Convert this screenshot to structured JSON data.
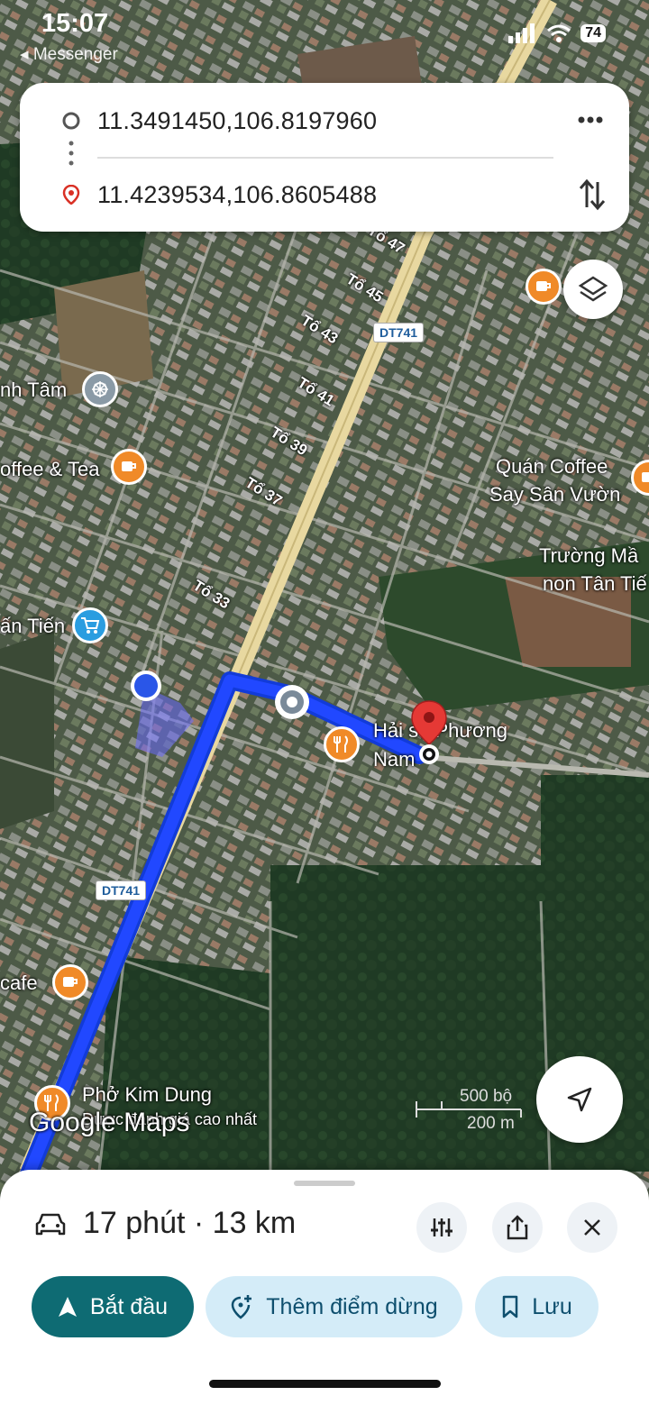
{
  "status_bar": {
    "time": "15:07",
    "back_app": "Messenger",
    "battery": "74"
  },
  "route": {
    "origin": "11.3491450,106.8197960",
    "destination": "11.4239534,106.8605488"
  },
  "map": {
    "road_shields": [
      "DT741",
      "DT741"
    ],
    "street_labels": [
      "Tổ 47",
      "Tổ 45",
      "Tổ 43",
      "Tổ 41",
      "Tổ 39",
      "Tổ 37",
      "Tổ 33"
    ],
    "places": {
      "p1": "nh Tâm",
      "p2": "offee & Tea",
      "p3_line1": "Quán Coffee",
      "p3_line2": "Say Sân Vườn",
      "p4_line1": "Trường Mầ",
      "p4_line2": "non Tân Tiế",
      "p5": "ấn Tiến",
      "p6_line1": "Hải sả Phương",
      "p6_line2": "Nam",
      "p7": "cafe",
      "p8": "Phở Kim Dung",
      "p9": "Được đánh giá cao nhất"
    },
    "watermark": "Google Maps",
    "scale": {
      "imperial": "500 bộ",
      "metric": "200 m"
    },
    "route_color": "#1a3dff",
    "pin_color": "#e53935"
  },
  "sheet": {
    "summary": "17 phút · 13 km",
    "start_label": "Bắt đầu",
    "add_stop_label": "Thêm điểm dừng",
    "save_label": "Lưu"
  }
}
